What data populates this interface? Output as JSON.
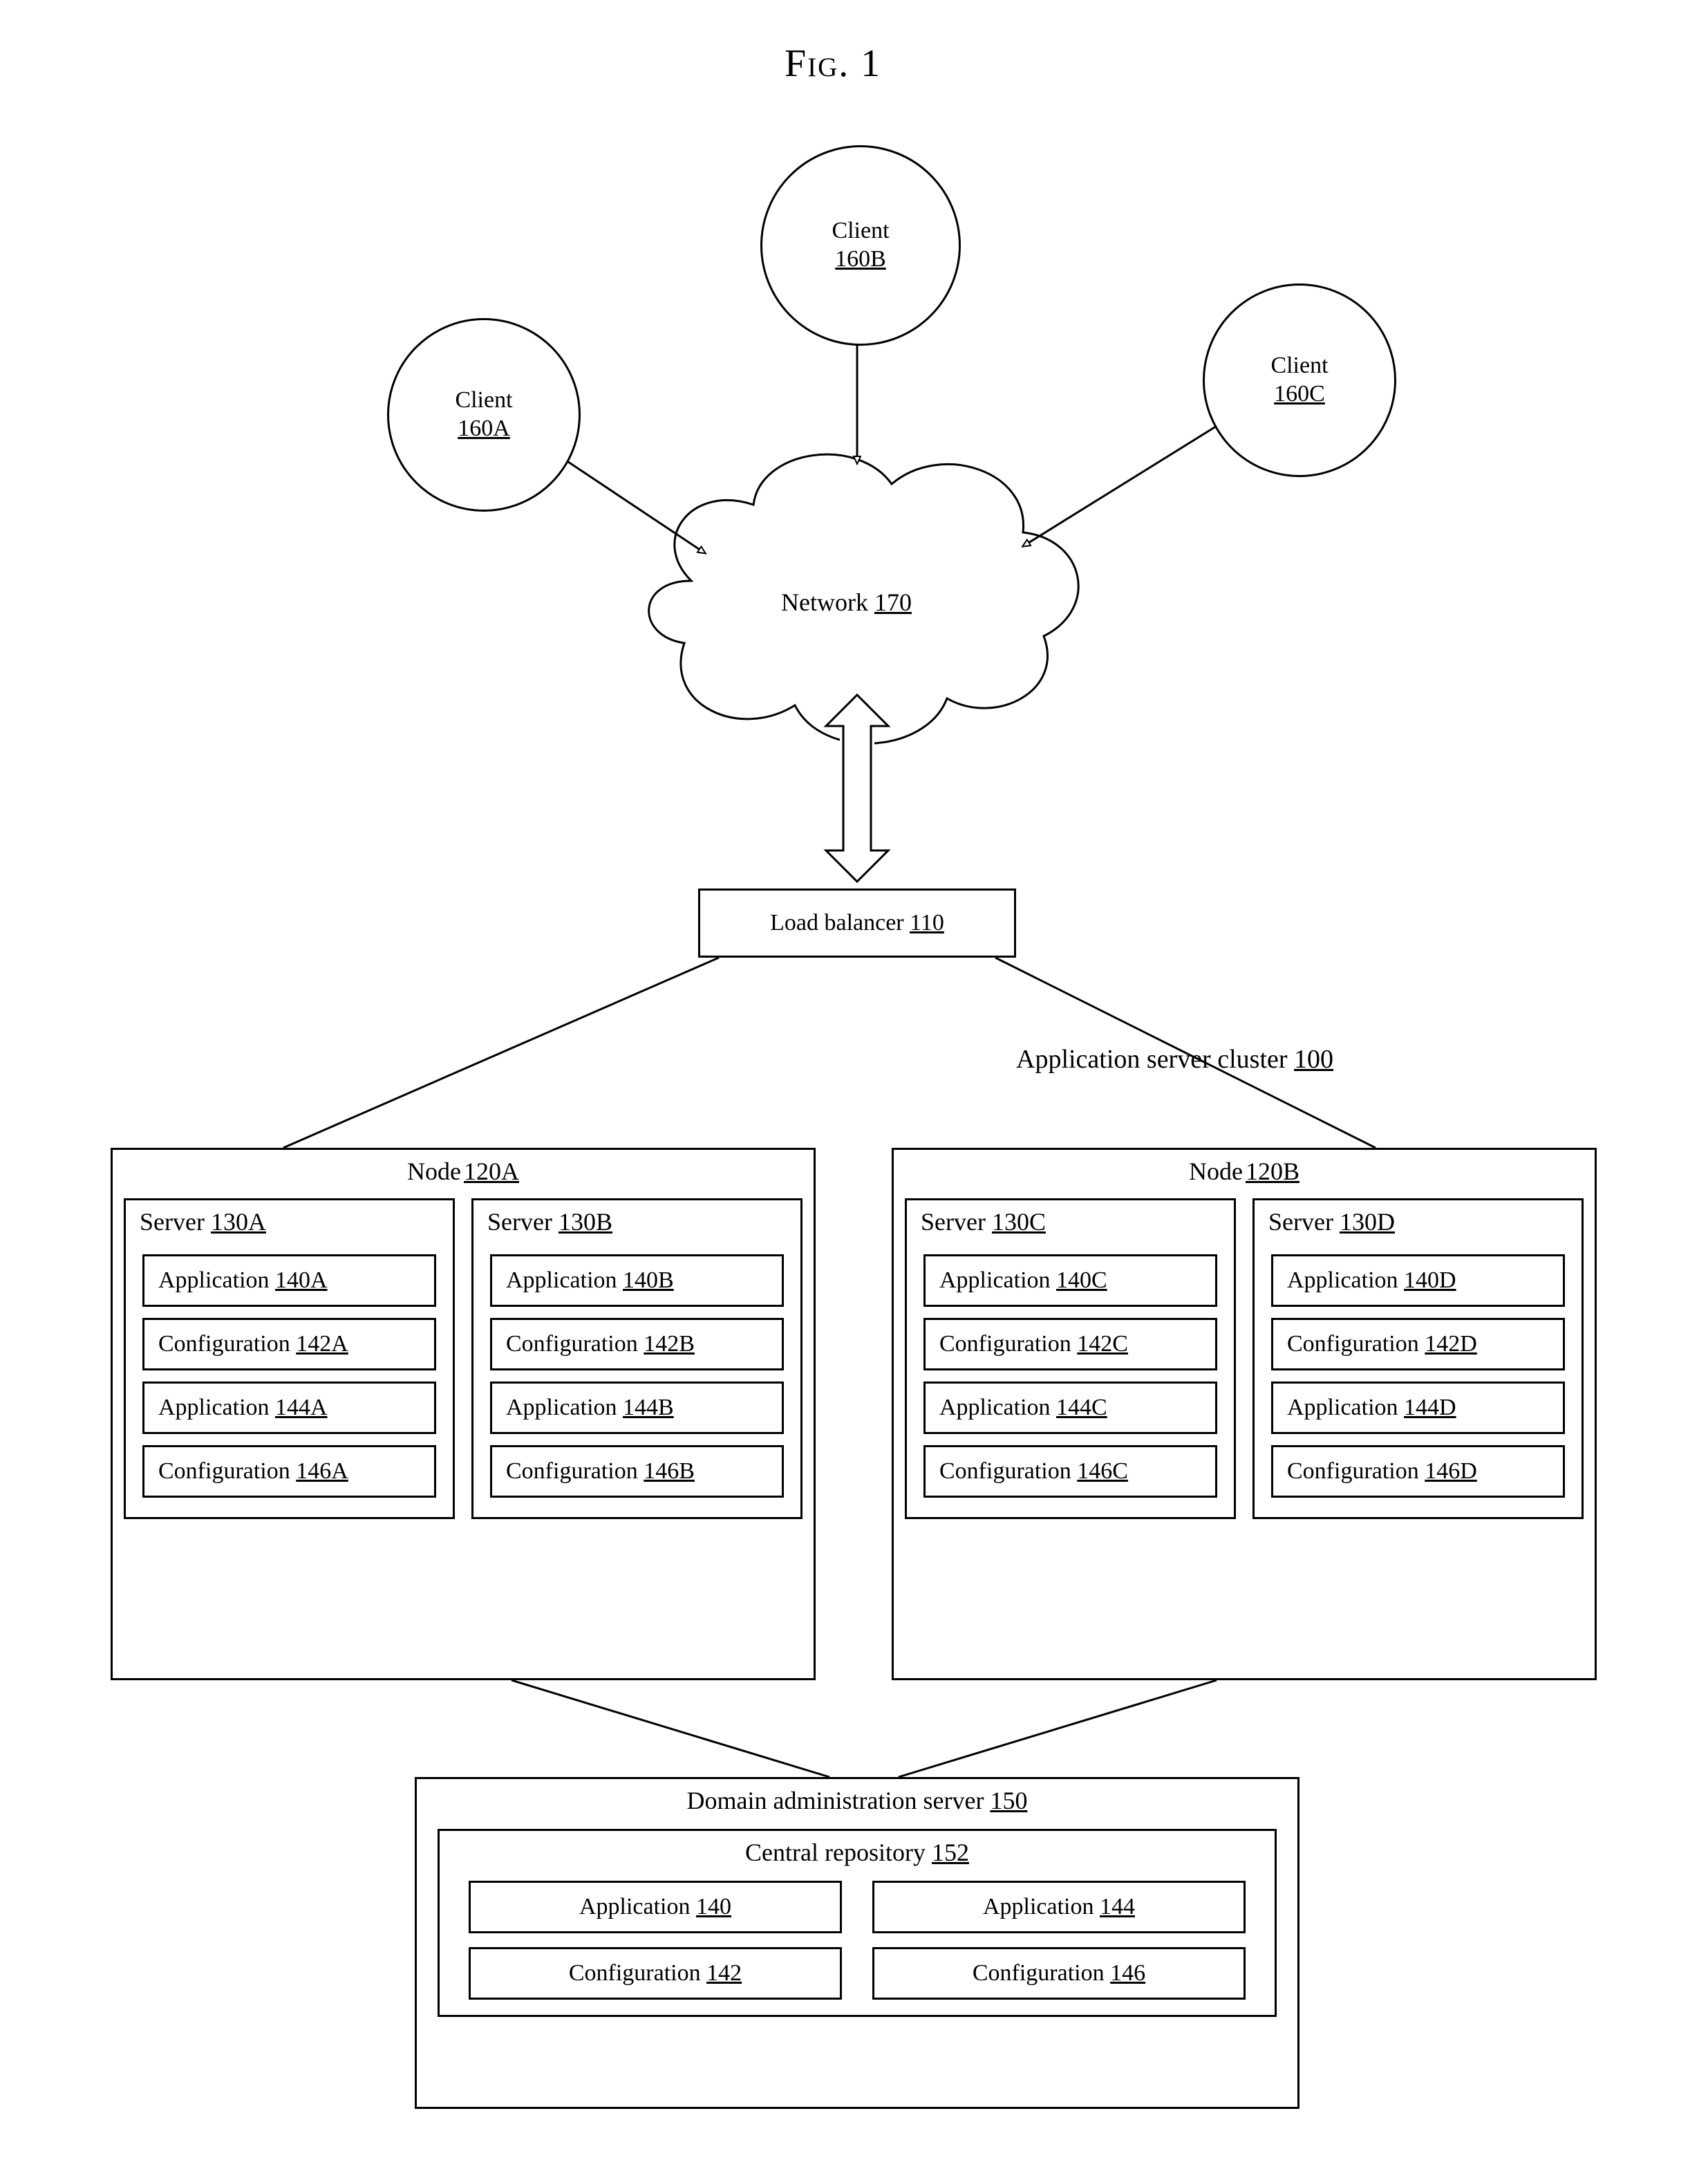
{
  "figure_title": "Fig. 1",
  "clients": {
    "a": {
      "label": "Client",
      "ref": "160A"
    },
    "b": {
      "label": "Client",
      "ref": "160B"
    },
    "c": {
      "label": "Client",
      "ref": "160C"
    }
  },
  "network": {
    "label": "Network",
    "ref": "170"
  },
  "load_balancer": {
    "label": "Load balancer",
    "ref": "110"
  },
  "cluster_label": {
    "label": "Application server cluster",
    "ref": "100"
  },
  "nodes": {
    "a": {
      "label": "Node",
      "ref": "120A",
      "servers": [
        {
          "label": "Server",
          "ref": "130A",
          "items": [
            {
              "label": "Application",
              "ref": "140A"
            },
            {
              "label": "Configuration",
              "ref": "142A"
            },
            {
              "label": "Application",
              "ref": "144A"
            },
            {
              "label": "Configuration",
              "ref": "146A"
            }
          ]
        },
        {
          "label": "Server",
          "ref": "130B",
          "items": [
            {
              "label": "Application",
              "ref": "140B"
            },
            {
              "label": "Configuration",
              "ref": "142B"
            },
            {
              "label": "Application",
              "ref": "144B"
            },
            {
              "label": "Configuration",
              "ref": "146B"
            }
          ]
        }
      ]
    },
    "b": {
      "label": "Node",
      "ref": "120B",
      "servers": [
        {
          "label": "Server",
          "ref": "130C",
          "items": [
            {
              "label": "Application",
              "ref": "140C"
            },
            {
              "label": "Configuration",
              "ref": "142C"
            },
            {
              "label": "Application",
              "ref": "144C"
            },
            {
              "label": "Configuration",
              "ref": "146C"
            }
          ]
        },
        {
          "label": "Server",
          "ref": "130D",
          "items": [
            {
              "label": "Application",
              "ref": "140D"
            },
            {
              "label": "Configuration",
              "ref": "142D"
            },
            {
              "label": "Application",
              "ref": "144D"
            },
            {
              "label": "Configuration",
              "ref": "146D"
            }
          ]
        }
      ]
    }
  },
  "das": {
    "label": "Domain administration server",
    "ref": "150",
    "repo": {
      "label": "Central repository",
      "ref": "152",
      "items_row1": [
        {
          "label": "Application",
          "ref": "140"
        },
        {
          "label": "Application",
          "ref": "144"
        }
      ],
      "items_row2": [
        {
          "label": "Configuration",
          "ref": "142"
        },
        {
          "label": "Configuration",
          "ref": "146"
        }
      ]
    }
  }
}
